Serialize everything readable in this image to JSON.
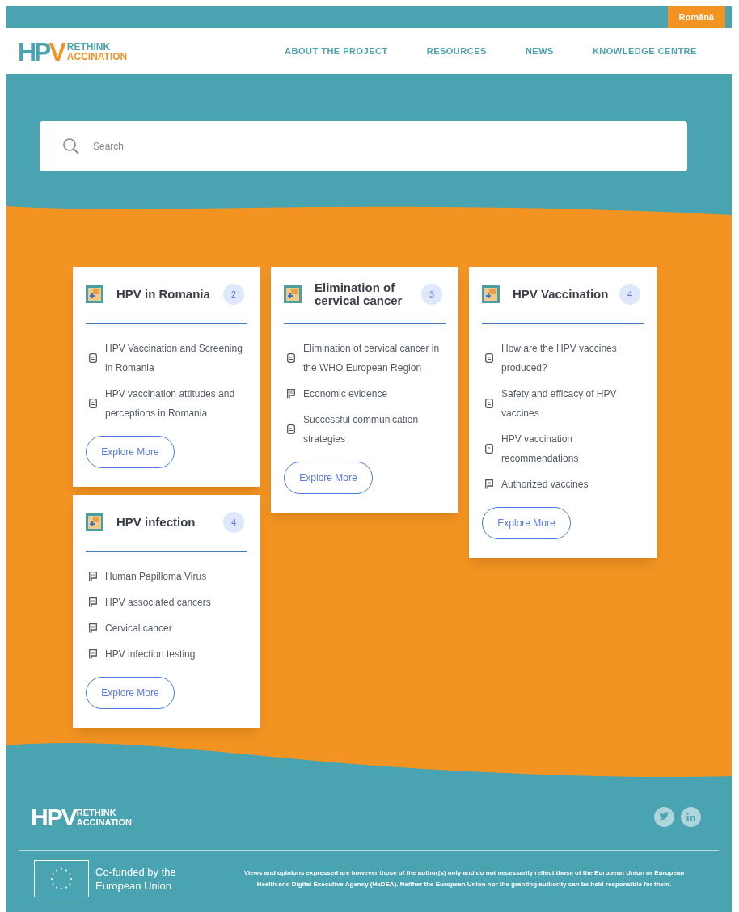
{
  "top_bar": {
    "language_button": "Română"
  },
  "header": {
    "logo": {
      "mark_1": "HP",
      "mark_2": "V",
      "line_1": "RETHINK",
      "line_2": "ACCINATION"
    },
    "nav": [
      "ABOUT THE PROJECT",
      "RESOURCES",
      "NEWS",
      "KNOWLEDGE CENTRE"
    ]
  },
  "search": {
    "placeholder": "Search"
  },
  "columns": [
    [
      {
        "title": "HPV in Romania",
        "count": "2",
        "items": [
          {
            "kind": "document",
            "text": "HPV Vaccination and Screening in Romania"
          },
          {
            "kind": "document",
            "text": "HPV vaccination attitudes and perceptions in Romania"
          }
        ],
        "button": "Explore More"
      },
      {
        "title": "HPV infection",
        "count": "4",
        "items": [
          {
            "kind": "page",
            "text": "Human Papilloma Virus"
          },
          {
            "kind": "page",
            "text": "HPV associated cancers"
          },
          {
            "kind": "page",
            "text": "Cervical cancer"
          },
          {
            "kind": "page",
            "text": "HPV infection testing"
          }
        ],
        "button": "Explore More"
      }
    ],
    [
      {
        "title": "Elimination of cervical cancer",
        "count": "3",
        "items": [
          {
            "kind": "document",
            "text": "Elimination of cervical cancer in the WHO European Region"
          },
          {
            "kind": "page",
            "text": "Economic evidence"
          },
          {
            "kind": "document",
            "text": "Successful communication strategies"
          }
        ],
        "button": "Explore More"
      }
    ],
    [
      {
        "title": "HPV Vaccination",
        "count": "4",
        "items": [
          {
            "kind": "document",
            "text": "How are the HPV vaccines produced?"
          },
          {
            "kind": "document",
            "text": "Safety and efficacy of HPV vaccines"
          },
          {
            "kind": "document",
            "text": "HPV vaccination recommendations"
          },
          {
            "kind": "page",
            "text": "Authorized vaccines"
          }
        ],
        "button": "Explore More"
      }
    ]
  ],
  "footer": {
    "logo": {
      "mark": "HPV",
      "line_1": "RETHINK",
      "line_2": "ACCINATION"
    },
    "eu_label": "Co-funded by the European Union",
    "disclaimer": "Views and opinions expressed are however those of the author(s) only and do not necessarily reflect those of the European Union or European Health and Digital Executive Agency (HaDEA). Neither the European Union nor the granting authority can be held responsible for them."
  }
}
